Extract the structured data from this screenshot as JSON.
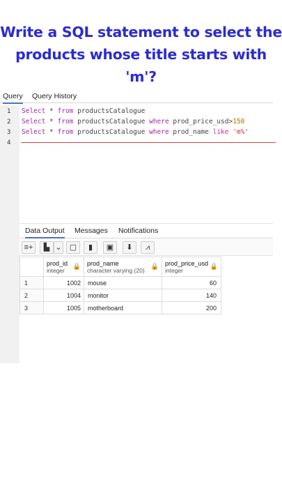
{
  "headline": {
    "line1": "Write  a SQL statement to select the",
    "line2": "products whose title starts with 'm'?"
  },
  "query_tabs": [
    "Query",
    "Query History"
  ],
  "editor": {
    "line_numbers": [
      "1",
      "2",
      "3",
      "4"
    ],
    "lines": [
      [
        {
          "t": "Select",
          "c": "kw"
        },
        {
          "t": " * ",
          "c": ""
        },
        {
          "t": "from",
          "c": "kw"
        },
        {
          "t": " productsCatalogue",
          "c": ""
        }
      ],
      [
        {
          "t": "Select",
          "c": "kw"
        },
        {
          "t": " * ",
          "c": ""
        },
        {
          "t": "from",
          "c": "kw"
        },
        {
          "t": " productsCatalogue ",
          "c": ""
        },
        {
          "t": "where",
          "c": "kw"
        },
        {
          "t": " prod_price_usd>",
          "c": ""
        },
        {
          "t": "150",
          "c": "num"
        }
      ],
      [
        {
          "t": "Select",
          "c": "kw"
        },
        {
          "t": " * ",
          "c": ""
        },
        {
          "t": "from",
          "c": "kw"
        },
        {
          "t": " productsCatalogue ",
          "c": ""
        },
        {
          "t": "where",
          "c": "kw"
        },
        {
          "t": " prod_name ",
          "c": ""
        },
        {
          "t": "like",
          "c": "kw2"
        },
        {
          "t": " 'm%'",
          "c": "str"
        }
      ]
    ]
  },
  "output_tabs": [
    "Data Output",
    "Messages",
    "Notifications"
  ],
  "toolbar_icons": [
    "add-row-icon",
    "copy-icon",
    "chevron-down-icon",
    "paste-icon",
    "delete-icon",
    "save-data-icon",
    "download-icon",
    "graph-icon"
  ],
  "result": {
    "columns": [
      {
        "name": "prod_id",
        "type": "integer"
      },
      {
        "name": "prod_name",
        "type": "character varying (20)"
      },
      {
        "name": "prod_price_usd",
        "type": "integer"
      }
    ],
    "rows": [
      {
        "n": "1",
        "id": "1002",
        "name": "mouse",
        "price": "60"
      },
      {
        "n": "2",
        "id": "1004",
        "name": "monitor",
        "price": "140"
      },
      {
        "n": "3",
        "id": "1005",
        "name": "motherboard",
        "price": "200"
      }
    ]
  },
  "colors": {
    "headline": "#2b2bd0",
    "keyword": "#a626a4",
    "accent": "#4a73b8"
  }
}
